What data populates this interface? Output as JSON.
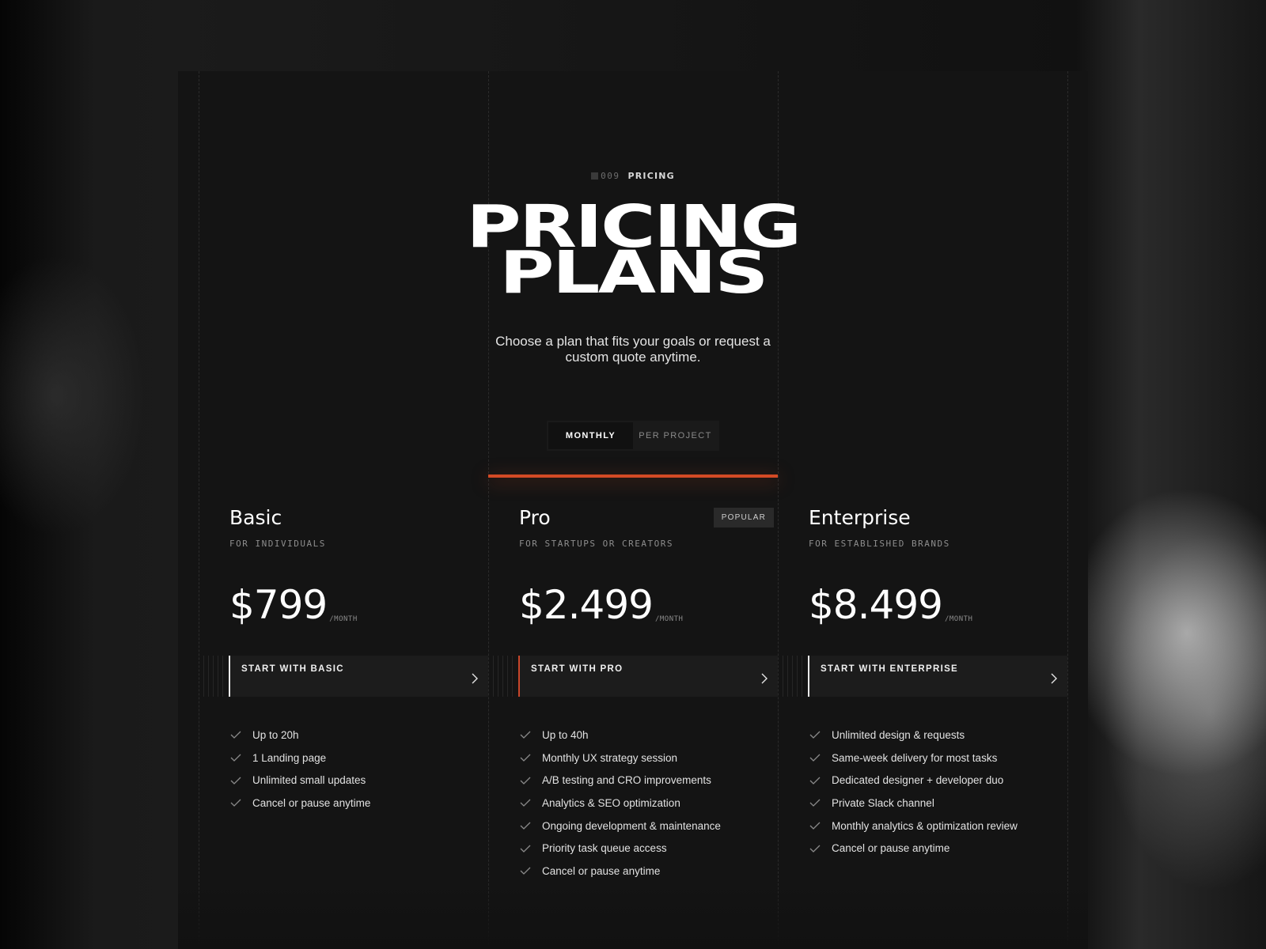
{
  "eyebrow": {
    "number": "009",
    "label": "PRICING"
  },
  "title": {
    "line1": "PRICING",
    "line2": "PLANS"
  },
  "subtitle": "Choose a plan that fits your goals or request a custom quote anytime.",
  "billing_toggle": {
    "options": [
      "MONTHLY",
      "PER PROJECT"
    ],
    "selected": "MONTHLY"
  },
  "colors": {
    "accent": "#d34a25",
    "background": "#141414"
  },
  "plans": [
    {
      "name": "Basic",
      "audience": "FOR INDIVIDUALS",
      "price": "$799",
      "period": "/MONTH",
      "cta": "START WITH BASIC",
      "features": [
        "Up to 20h",
        "1 Landing page",
        "Unlimited small updates",
        "Cancel or pause anytime"
      ]
    },
    {
      "name": "Pro",
      "badge": "POPULAR",
      "audience": "FOR STARTUPS OR CREATORS",
      "price": "$2.499",
      "period": "/MONTH",
      "cta": "START WITH PRO",
      "features": [
        "Up to 40h",
        "Monthly UX strategy session",
        "A/B testing and CRO improvements",
        "Analytics & SEO optimization",
        "Ongoing development & maintenance",
        "Priority task queue access",
        "Cancel or pause anytime"
      ]
    },
    {
      "name": "Enterprise",
      "audience": "FOR ESTABLISHED BRANDS",
      "price": "$8.499",
      "period": "/MONTH",
      "cta": "START WITH ENTERPRISE",
      "features": [
        "Unlimited design & requests",
        "Same-week delivery for most tasks",
        "Dedicated designer + developer duo",
        "Private Slack channel",
        "Monthly analytics & optimization review",
        "Cancel or pause anytime"
      ]
    }
  ]
}
